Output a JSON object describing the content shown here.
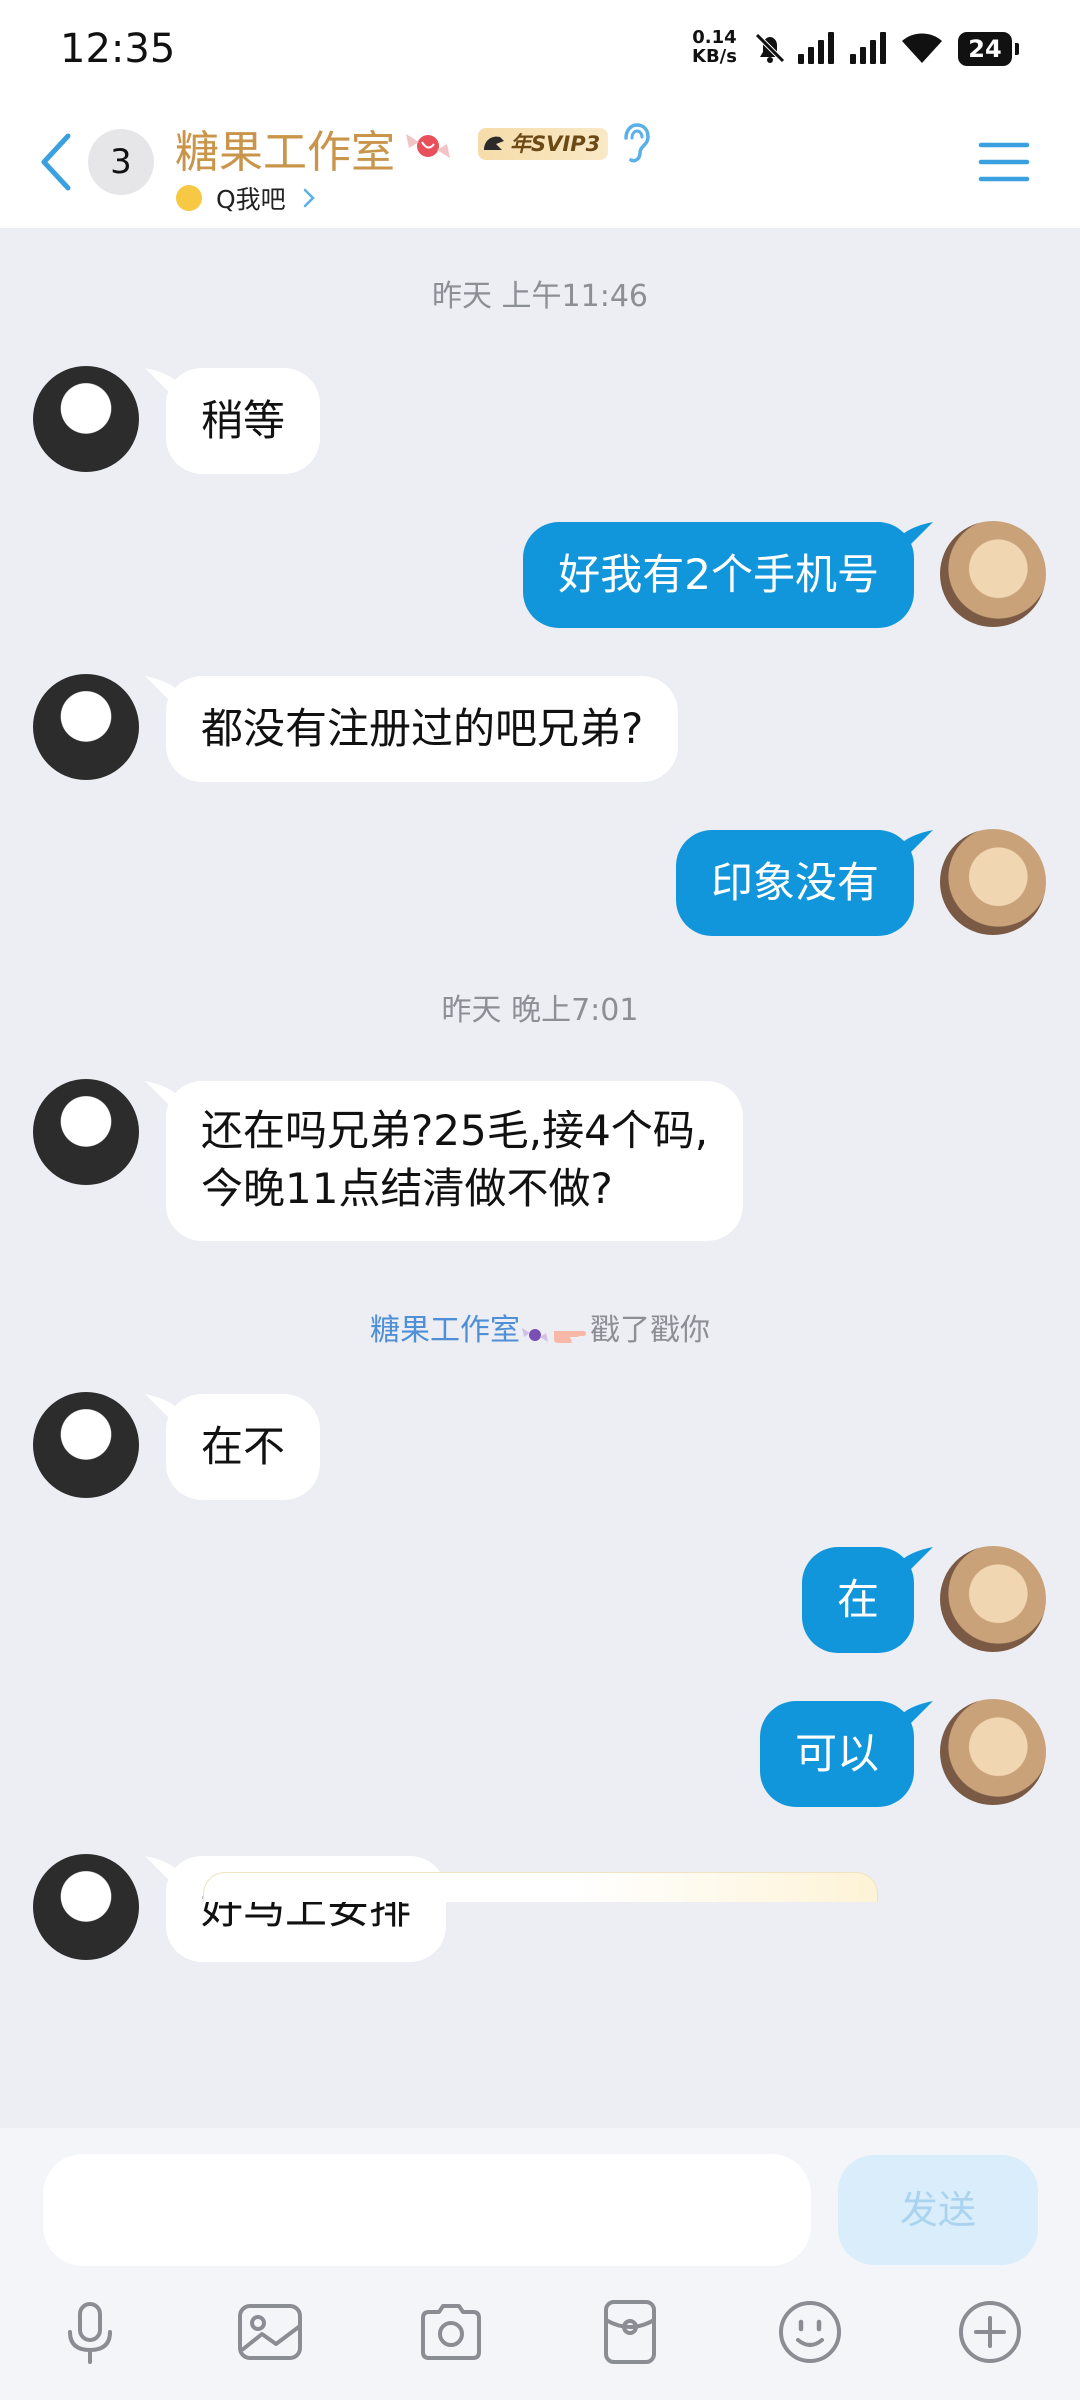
{
  "status_bar": {
    "time": "12:35",
    "net_speed_value": "0.14",
    "net_speed_unit": "KB/s",
    "battery": "24",
    "icons": [
      "bell-off-icon",
      "signal-icon",
      "signal-icon",
      "wifi-icon",
      "battery-icon"
    ]
  },
  "header": {
    "unread_count": "3",
    "title": "糖果工作室",
    "badge": "年SVIP3",
    "subtitle": "Q我吧",
    "icons": [
      "back-arrow-icon",
      "candy-icon",
      "svip-helmet-icon",
      "ear-icon",
      "smile-emoji-icon",
      "chevron-right-icon",
      "menu-icon"
    ]
  },
  "chat": {
    "timestamps": [
      "昨天 上午11:46",
      "昨天 晚上7:01"
    ],
    "messages": [
      {
        "side": "in",
        "text": "稍等"
      },
      {
        "side": "out",
        "text": "好我有2个手机号"
      },
      {
        "side": "in",
        "text": "都没有注册过的吧兄弟?"
      },
      {
        "side": "out",
        "text": "印象没有"
      },
      {
        "side": "in",
        "line1": "还在吗兄弟?25毛,接4个码,",
        "line2": "今晚11点结清做不做?"
      },
      {
        "side": "in",
        "text": "在不"
      },
      {
        "side": "out",
        "text": "在"
      },
      {
        "side": "out",
        "text": "可以"
      },
      {
        "side": "in",
        "text": "好马上安排"
      }
    ],
    "poke": {
      "name": "糖果工作室",
      "action": "戳了戳你"
    }
  },
  "input": {
    "placeholder": "",
    "send_label": "发送",
    "tools": [
      "microphone-icon",
      "image-icon",
      "camera-icon",
      "red-packet-icon",
      "emoji-icon",
      "plus-icon"
    ]
  },
  "colors": {
    "outgoing_bubble": "#1296db",
    "incoming_bubble": "#ffffff",
    "background": "#eceef3",
    "title": "#c9954a",
    "accent": "#3aa0e0"
  }
}
